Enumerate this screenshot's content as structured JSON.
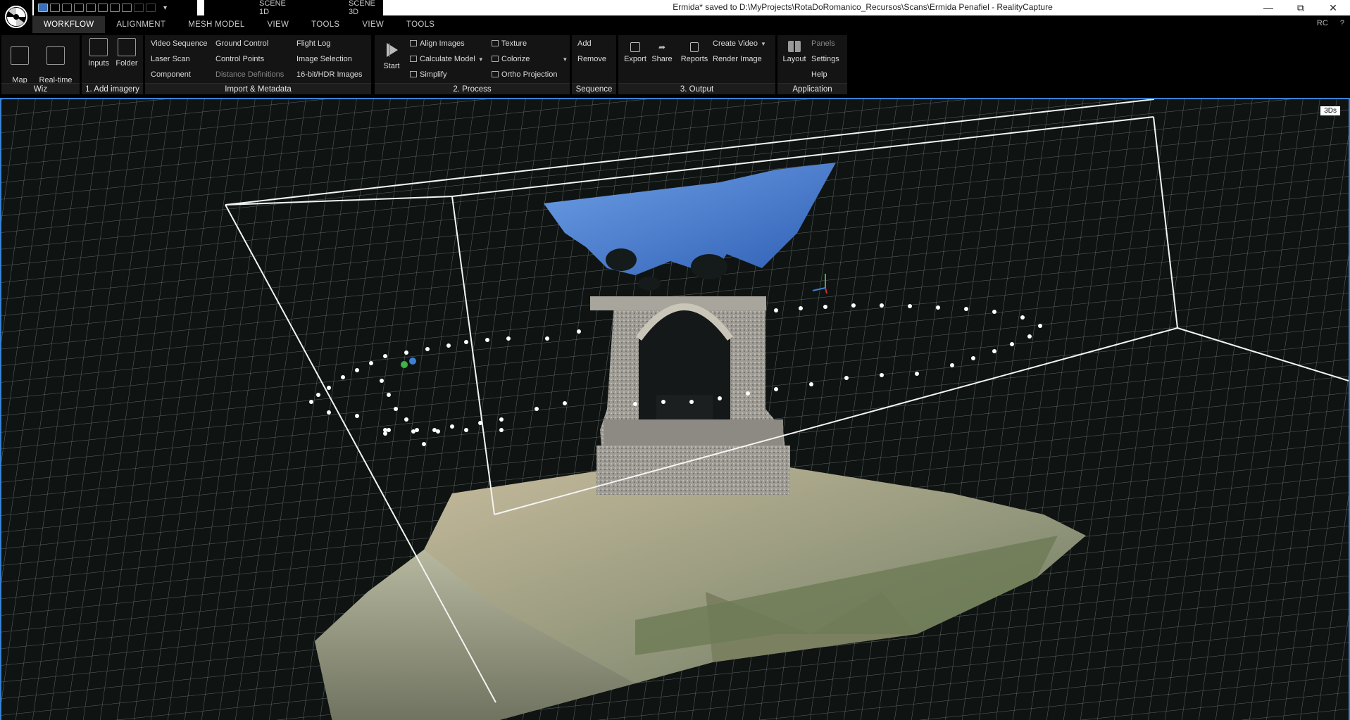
{
  "window": {
    "title": "Ermida* saved to D:\\MyProjects\\RotaDoRomanico_Recursos\\Scans\\Ermida Penafiel - RealityCapture",
    "minimize_icon": "minimize-icon",
    "restore_icon": "restore-icon",
    "close_icon": "close-icon"
  },
  "scene_tabs": [
    "SCENE 1D",
    "SCENE 3D"
  ],
  "menu_tabs": [
    "WORKFLOW",
    "ALIGNMENT",
    "MESH MODEL",
    "VIEW",
    "TOOLS",
    "VIEW",
    "TOOLS"
  ],
  "menu_right": {
    "rc": "RC",
    "help": "?"
  },
  "ribbon": {
    "wiz": {
      "label": "Wiz",
      "map_wizard": "Map\nWizard",
      "realtime": "Real-time\nAssistance"
    },
    "add_imagery": {
      "label": "1. Add imagery",
      "inputs": "Inputs",
      "folder": "Folder"
    },
    "import": {
      "label": "Import & Metadata",
      "video_sequence": "Video Sequence",
      "laser_scan": "Laser Scan",
      "component": "Component",
      "ground_control": "Ground Control",
      "control_points": "Control Points",
      "distance_definitions": "Distance Definitions",
      "flight_log": "Flight Log",
      "image_selection": "Image Selection",
      "hdr_images": "16-bit/HDR Images"
    },
    "process": {
      "label": "2. Process",
      "start": "Start",
      "align_images": "Align Images",
      "calculate_model": "Calculate Model",
      "simplify": "Simplify",
      "texture": "Texture",
      "colorize": "Colorize",
      "ortho_projection": "Ortho Projection"
    },
    "sequence": {
      "label": "Sequence",
      "add": "Add",
      "remove": "Remove"
    },
    "output": {
      "label": "3. Output",
      "export": "Export",
      "share": "Share",
      "reports": "Reports",
      "create_video": "Create Video",
      "render_image": "Render Image"
    },
    "application": {
      "label": "Application",
      "layout": "Layout",
      "panels": "Panels",
      "settings": "Settings",
      "help": "Help"
    }
  },
  "viewport": {
    "badge": "3Ds"
  },
  "colors": {
    "accent": "#3b82d6",
    "sky_mesh": "#4a7fd0",
    "grid": "#b8c4c4"
  }
}
